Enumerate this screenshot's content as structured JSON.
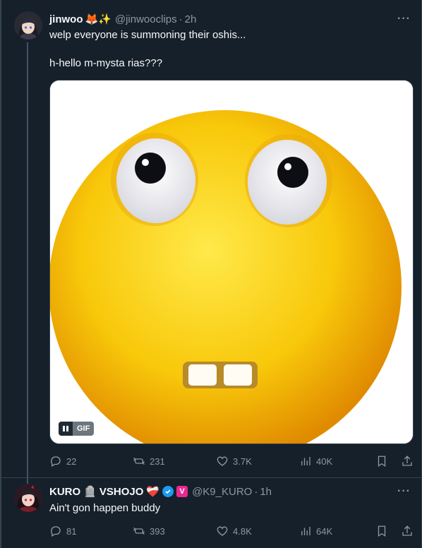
{
  "tweet1": {
    "display_name": "jinwoo",
    "name_emojis": "🦊✨",
    "handle": "@jinwooclips",
    "time": "2h",
    "text": "welp everyone is summoning their oshis...\n\nh-hello m-mysta rias???",
    "media": {
      "badge_label": "GIF"
    },
    "stats": {
      "replies": "22",
      "reposts": "231",
      "likes": "3.7K",
      "views": "40K"
    }
  },
  "tweet2": {
    "display_name_part1": "KURO",
    "display_name_part2": "VSHOJO",
    "name_emojis": "🪦",
    "heart_emoji": "❤️‍🩹",
    "v_badge": "V",
    "handle": "@K9_KURO",
    "time": "1h",
    "text": "Ain't gon happen buddy",
    "stats": {
      "replies": "81",
      "reposts": "393",
      "likes": "4.8K",
      "views": "64K"
    }
  },
  "ui": {
    "more": "···",
    "dot": "·"
  },
  "icons": [
    "reply-icon",
    "repost-icon",
    "like-icon",
    "views-icon",
    "bookmark-icon",
    "share-icon",
    "pause-icon",
    "verified-icon",
    "more-icon"
  ],
  "colors": {
    "background": "#15202b",
    "text": "#f7f9f9",
    "muted": "#8b98a5",
    "divider": "#38444d",
    "accent": "#1d9bf0"
  }
}
